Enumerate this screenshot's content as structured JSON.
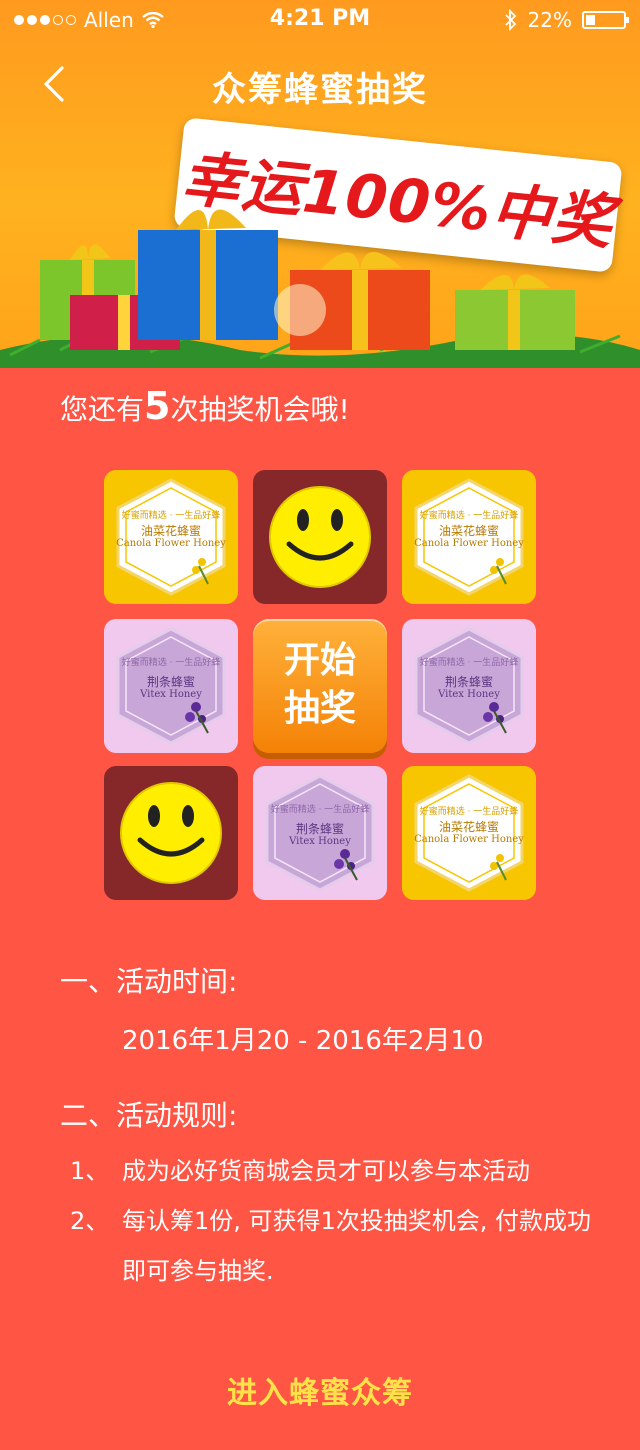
{
  "status_bar": {
    "carrier": "Allen",
    "time": "4:21 PM",
    "battery": "22%",
    "signal_bars_filled": 3,
    "signal_bars_total": 5,
    "battery_level": 0.22
  },
  "nav": {
    "title": "众筹蜂蜜抽奖"
  },
  "banner": {
    "slogan": "幸运100%中奖"
  },
  "lottery": {
    "chances_prefix": "您还有",
    "chances_count": "5",
    "chances_suffix": "次抽奖机会哦!",
    "start_line1": "开始",
    "start_line2": "抽奖",
    "prizes": {
      "canola": {
        "tagline": "好蜜而精选 · 一生品好蜂",
        "name_cn": "油菜花蜂蜜",
        "name_en": "Canola Flower Honey"
      },
      "vitex": {
        "tagline": "好蜜而精选 · 一生品好蜂",
        "name_cn": "荆条蜂蜜",
        "name_en": "Vitex Honey"
      }
    }
  },
  "rules": {
    "time_heading": "一、活动时间:",
    "time_value": "2016年1月20 - 2016年2月10",
    "rules_heading": "二、活动规则:",
    "items": [
      {
        "num": "1、",
        "text": "成为必好货商城会员才可以参与本活动"
      },
      {
        "num": "2、",
        "text": "每认筹1份, 可获得1次投抽奖机会, 付款成功即可参与抽奖."
      }
    ]
  },
  "cta": {
    "label": "进入蜂蜜众筹"
  },
  "colors": {
    "background": "#ff5544",
    "banner": "#ffa31a",
    "cta_text": "#ffe24a",
    "slogan_red": "#e5181c",
    "tile_yellow": "#f7c600",
    "tile_purple": "#f1c9ee",
    "tile_dark": "#86282a",
    "start_orange": "#f48206"
  }
}
